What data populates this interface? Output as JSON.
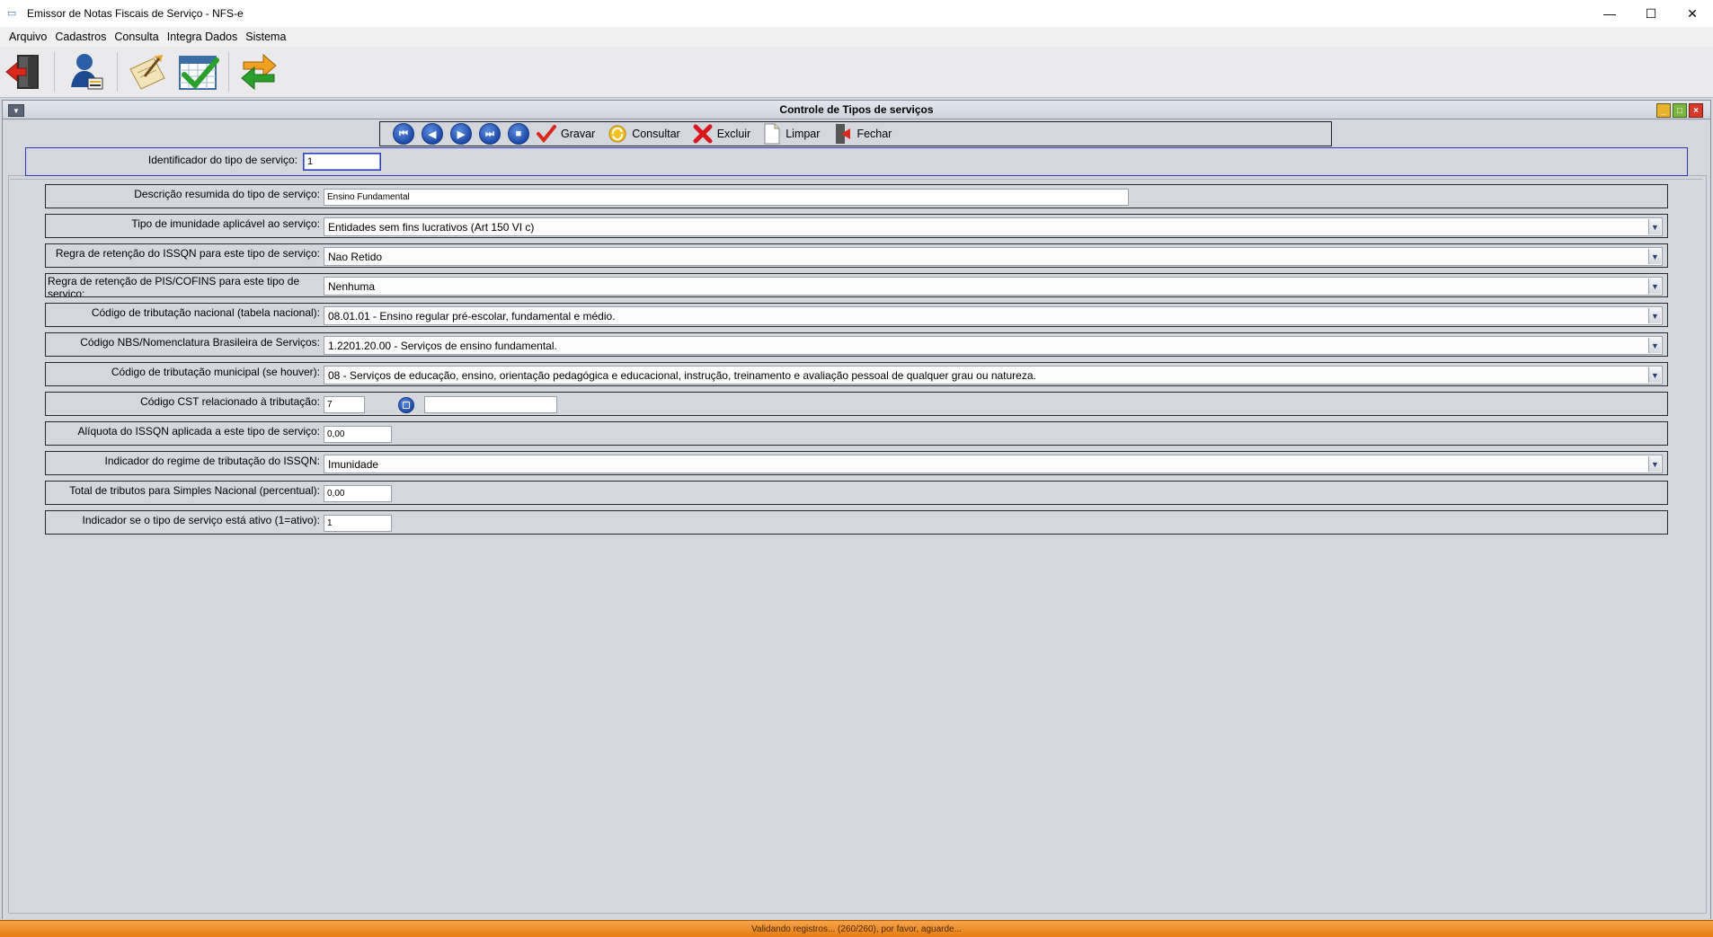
{
  "window": {
    "title": "Emissor de Notas Fiscais de Serviço - NFS-e",
    "min_glyph": "—",
    "max_glyph": "☐",
    "close_glyph": "✕"
  },
  "menu": [
    "Arquivo",
    "Cadastros",
    "Consulta",
    "Integra Dados",
    "Sistema"
  ],
  "toolbar": {
    "icons": [
      "exit-door-icon",
      "user-admin-icon",
      "edit-notes-icon",
      "calendar-check-icon",
      "sync-arrows-icon"
    ]
  },
  "frame": {
    "title": "Controle de Tipos de serviços"
  },
  "navbar": {
    "nav_icons": [
      "first-record-icon",
      "previous-record-icon",
      "next-record-icon",
      "last-record-icon",
      "stop-icon"
    ],
    "save_label": "Gravar",
    "query_label": "Consultar",
    "delete_label": "Excluir",
    "clear_label": "Limpar",
    "close_label": "Fechar"
  },
  "form": {
    "id_label": "Identificador do tipo de serviço:",
    "id_value": "1",
    "rows": [
      {
        "label": "Descrição resumida do tipo de serviço:",
        "value": "Ensino Fundamental"
      },
      {
        "label": "Tipo de imunidade aplicável ao serviço:",
        "value": "Entidades sem fins lucrativos (Art 150 VI c)"
      },
      {
        "label": "Regra de retenção do ISSQN para este tipo de serviço:",
        "value": "Nao Retido"
      },
      {
        "label": "Regra de retenção de PIS/COFINS para este tipo de serviço:",
        "value": "Nenhuma"
      },
      {
        "label": "Código de tributação nacional (tabela nacional):",
        "value": "08.01.01 - Ensino regular pré-escolar, fundamental e médio."
      },
      {
        "label": "Código NBS/Nomenclatura Brasileira de Serviços:",
        "value": "1.2201.20.00 - Serviços de ensino fundamental."
      },
      {
        "label": "Código de tributação municipal (se houver):",
        "value": "08 - Serviços de educação, ensino, orientação pedagógica e educacional, instrução, treinamento e avaliação pessoal de qualquer grau ou natureza."
      },
      {
        "label": "Código CST relacionado à tributação:",
        "value": "7",
        "extra": ""
      },
      {
        "label": "Alíquota do ISSQN aplicada a este tipo de serviço:",
        "value": "0,00"
      },
      {
        "label": "Indicador do regime de tributação do ISSQN:",
        "value": "Imunidade"
      },
      {
        "label": "Total de tributos para Simples Nacional (percentual):",
        "value": "0,00"
      },
      {
        "label": "Indicador se o tipo de serviço está ativo (1=ativo):",
        "value": "1"
      }
    ]
  },
  "status": {
    "text": "Validando registros... (260/260), por favor, aguarde..."
  }
}
